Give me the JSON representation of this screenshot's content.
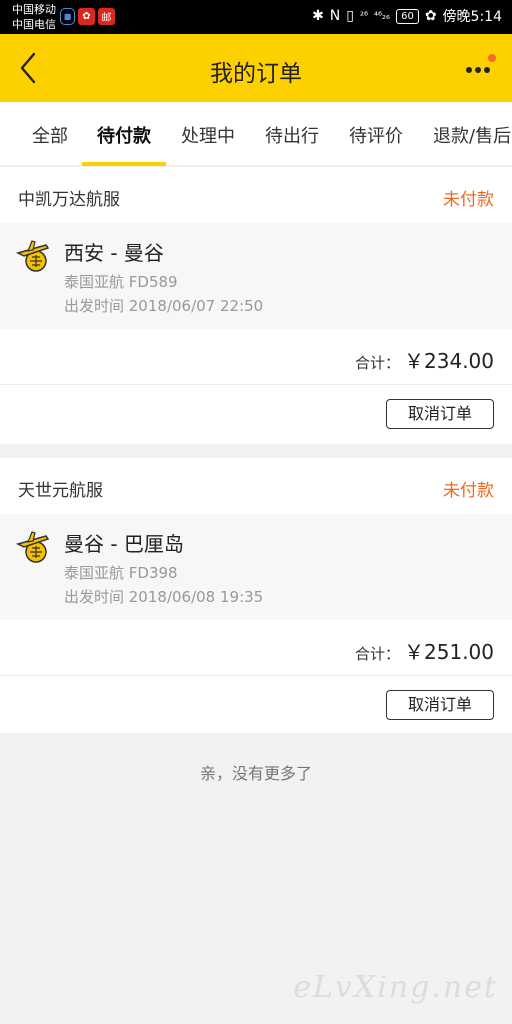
{
  "statusbar": {
    "carrier_1": "中国移动",
    "carrier_2": "中国电信",
    "red_icon_char": "邮",
    "signal_1": "²⁶",
    "signal_2": "⁴⁶₂₆",
    "battery": "60",
    "time": "傍晚5:14"
  },
  "header": {
    "title": "我的订单"
  },
  "tabs": [
    {
      "label": "全部"
    },
    {
      "label": "待付款"
    },
    {
      "label": "处理中"
    },
    {
      "label": "待出行"
    },
    {
      "label": "待评价"
    },
    {
      "label": "退款/售后"
    }
  ],
  "orders": [
    {
      "agency": "中凯万达航服",
      "status": "未付款",
      "route": "西安 - 曼谷",
      "airline": "泰国亚航 FD589",
      "departure": "出发时间 2018/06/07 22:50",
      "total_label": "合计：",
      "total": "￥234.00",
      "cancel_label": "取消订单"
    },
    {
      "agency": "天世元航服",
      "status": "未付款",
      "route": "曼谷 - 巴厘岛",
      "airline": "泰国亚航 FD398",
      "departure": "出发时间 2018/06/08 19:35",
      "total_label": "合计：",
      "total": "￥251.00",
      "cancel_label": "取消订单"
    }
  ],
  "footer": {
    "no_more": "亲，没有更多了"
  },
  "watermark": "eLvXing.net",
  "colors": {
    "accent": "#fdd000",
    "status": "#f0681e"
  }
}
